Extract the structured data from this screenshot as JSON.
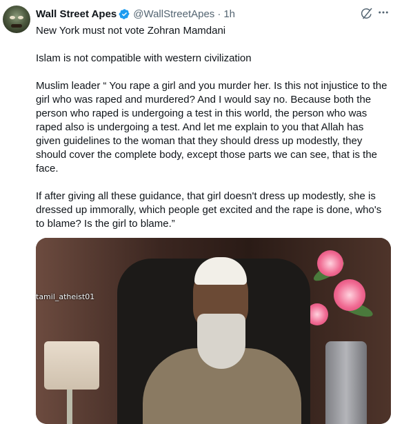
{
  "tweet": {
    "author_name": "Wall Street Apes",
    "handle": "@WallStreetApes",
    "separator": "·",
    "time": "1h",
    "paragraphs": [
      "New York must not vote Zohran Mamdani",
      "Islam is not compatible with western civilization",
      "Muslim leader “ You rape a girl and you murder her. Is this not injustice to the girl who was raped and murdered? And I would say no. Because both the person who raped is undergoing a test in this world, the person who was raped also is undergoing a test. And let me explain to you that Allah has given guidelines to the woman that they should dress up modestly, they should cover the complete body, except those parts we can see, that is the face.",
      "If after giving all these guidance, that girl doesn't dress up modestly, she is dressed up immorally, which people get excited and the rape is done, who's to blame? Is the girl to blame.”"
    ],
    "media": {
      "watermark": "tamil_atheist01"
    }
  },
  "icons": {
    "verified": "verified-badge-icon",
    "grok": "grok-icon",
    "more": "more-icon"
  },
  "colors": {
    "verified": "#1d9bf0",
    "text": "#0f1419",
    "secondary": "#536471"
  }
}
